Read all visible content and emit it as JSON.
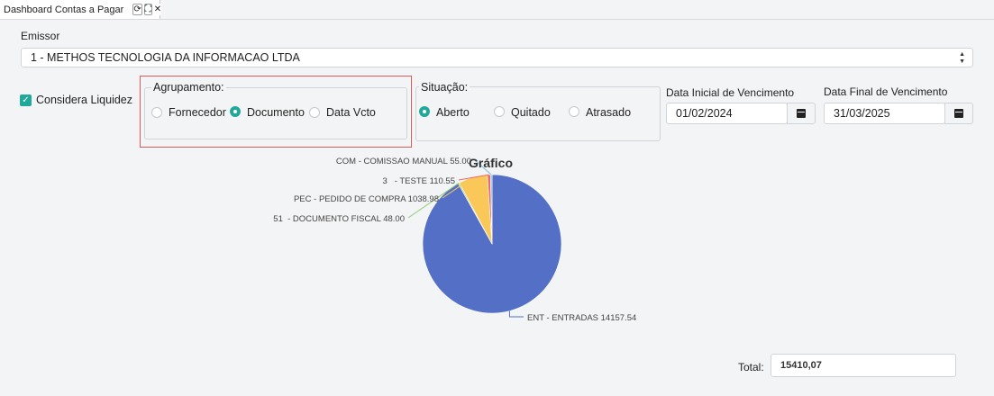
{
  "tab": {
    "title": "Dashboard Contas a Pagar",
    "refresh_icon": "refresh-icon",
    "expand_icon": "expand-icon",
    "close_icon": "close-icon"
  },
  "emissor": {
    "label": "Emissor",
    "value": "1 - METHOS TECNOLOGIA DA INFORMACAO LTDA"
  },
  "considera_liquidez": {
    "label": "Considera Liquidez",
    "checked": true
  },
  "agrupamento": {
    "legend": "Agrupamento:",
    "options": [
      "Fornecedor",
      "Documento",
      "Data Vcto"
    ],
    "selected": "Documento"
  },
  "situacao": {
    "legend": "Situação:",
    "options": [
      "Aberto",
      "Quitado",
      "Atrasado"
    ],
    "selected": "Aberto"
  },
  "data_inicial": {
    "label": "Data Inicial de Vencimento",
    "value": "01/02/2024"
  },
  "data_final": {
    "label": "Data Final de Vencimento",
    "value": "31/03/2025"
  },
  "colors": {
    "accent": "#20a89a",
    "highlight_border": "#e15a5a"
  },
  "chart_data": {
    "type": "pie",
    "title": "Gráfico",
    "slices": [
      {
        "label": "ENT - ENTRADAS 14157.54",
        "value": 14157.54,
        "color": "#5470c6"
      },
      {
        "label": "51  - DOCUMENTO FISCAL 48.00",
        "value": 48.0,
        "color": "#91cc75"
      },
      {
        "label": "PEC - PEDIDO DE COMPRA 1038.98",
        "value": 1038.98,
        "color": "#fac858"
      },
      {
        "label": "3   - TESTE 110.55",
        "value": 110.55,
        "color": "#ee6666"
      },
      {
        "label": "COM - COMISSAO MANUAL 55.00",
        "value": 55.0,
        "color": "#73c0de"
      }
    ]
  },
  "total": {
    "label": "Total:",
    "value": "15410,07"
  }
}
